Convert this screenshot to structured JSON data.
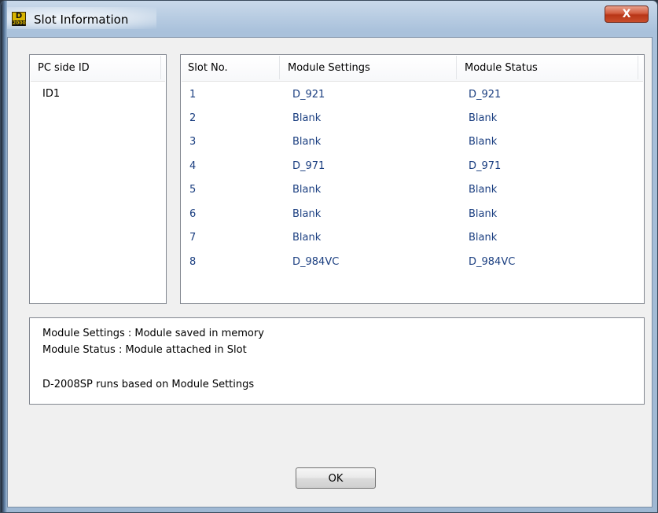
{
  "window": {
    "title": "Slot Information",
    "icon_top": "D",
    "icon_bottom": "2000",
    "close_glyph": "X"
  },
  "id_list": {
    "header": "PC side ID",
    "items": [
      "ID1"
    ]
  },
  "slot_table": {
    "columns": [
      "Slot No.",
      "Module Settings",
      "Module Status"
    ],
    "rows": [
      {
        "slot": "1",
        "settings": "D_921",
        "status": "D_921"
      },
      {
        "slot": "2",
        "settings": "Blank",
        "status": "Blank"
      },
      {
        "slot": "3",
        "settings": "Blank",
        "status": "Blank"
      },
      {
        "slot": "4",
        "settings": "D_971",
        "status": "D_971"
      },
      {
        "slot": "5",
        "settings": "Blank",
        "status": "Blank"
      },
      {
        "slot": "6",
        "settings": "Blank",
        "status": "Blank"
      },
      {
        "slot": "7",
        "settings": "Blank",
        "status": "Blank"
      },
      {
        "slot": "8",
        "settings": "D_984VC",
        "status": "D_984VC"
      }
    ]
  },
  "info": {
    "line1": "Module Settings : Module saved in memory",
    "line2": "Module Status : Module attached in Slot",
    "line3": "D-2008SP runs based on Module Settings"
  },
  "buttons": {
    "ok_label": "OK"
  },
  "colors": {
    "row_text": "#1a3e80",
    "close_button": "#c94d2b"
  }
}
